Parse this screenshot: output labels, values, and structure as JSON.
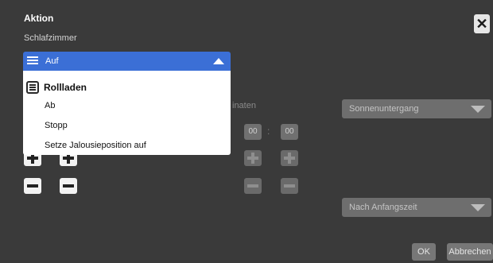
{
  "dialog": {
    "title": "Aktion",
    "subtitle": "Schlafzimmer",
    "close_icon": "close-icon"
  },
  "dropdown": {
    "selected": "Auf",
    "icon": "shutter-icon",
    "group_label": "Rollladen",
    "options": [
      "Ab",
      "Stopp",
      "Setze Jalousieposition auf"
    ]
  },
  "coordinates": {
    "label_partial": "inaten",
    "hour": "00",
    "minute": "00",
    "separator": ":"
  },
  "selects": {
    "sun_event": "Sonnenuntergang",
    "time_mode": "Nach Anfangszeit"
  },
  "footer": {
    "ok_label": "OK",
    "cancel_label": "Abbrechen"
  },
  "colors": {
    "accent": "#3b6fd6",
    "background": "#3a3a3a"
  }
}
